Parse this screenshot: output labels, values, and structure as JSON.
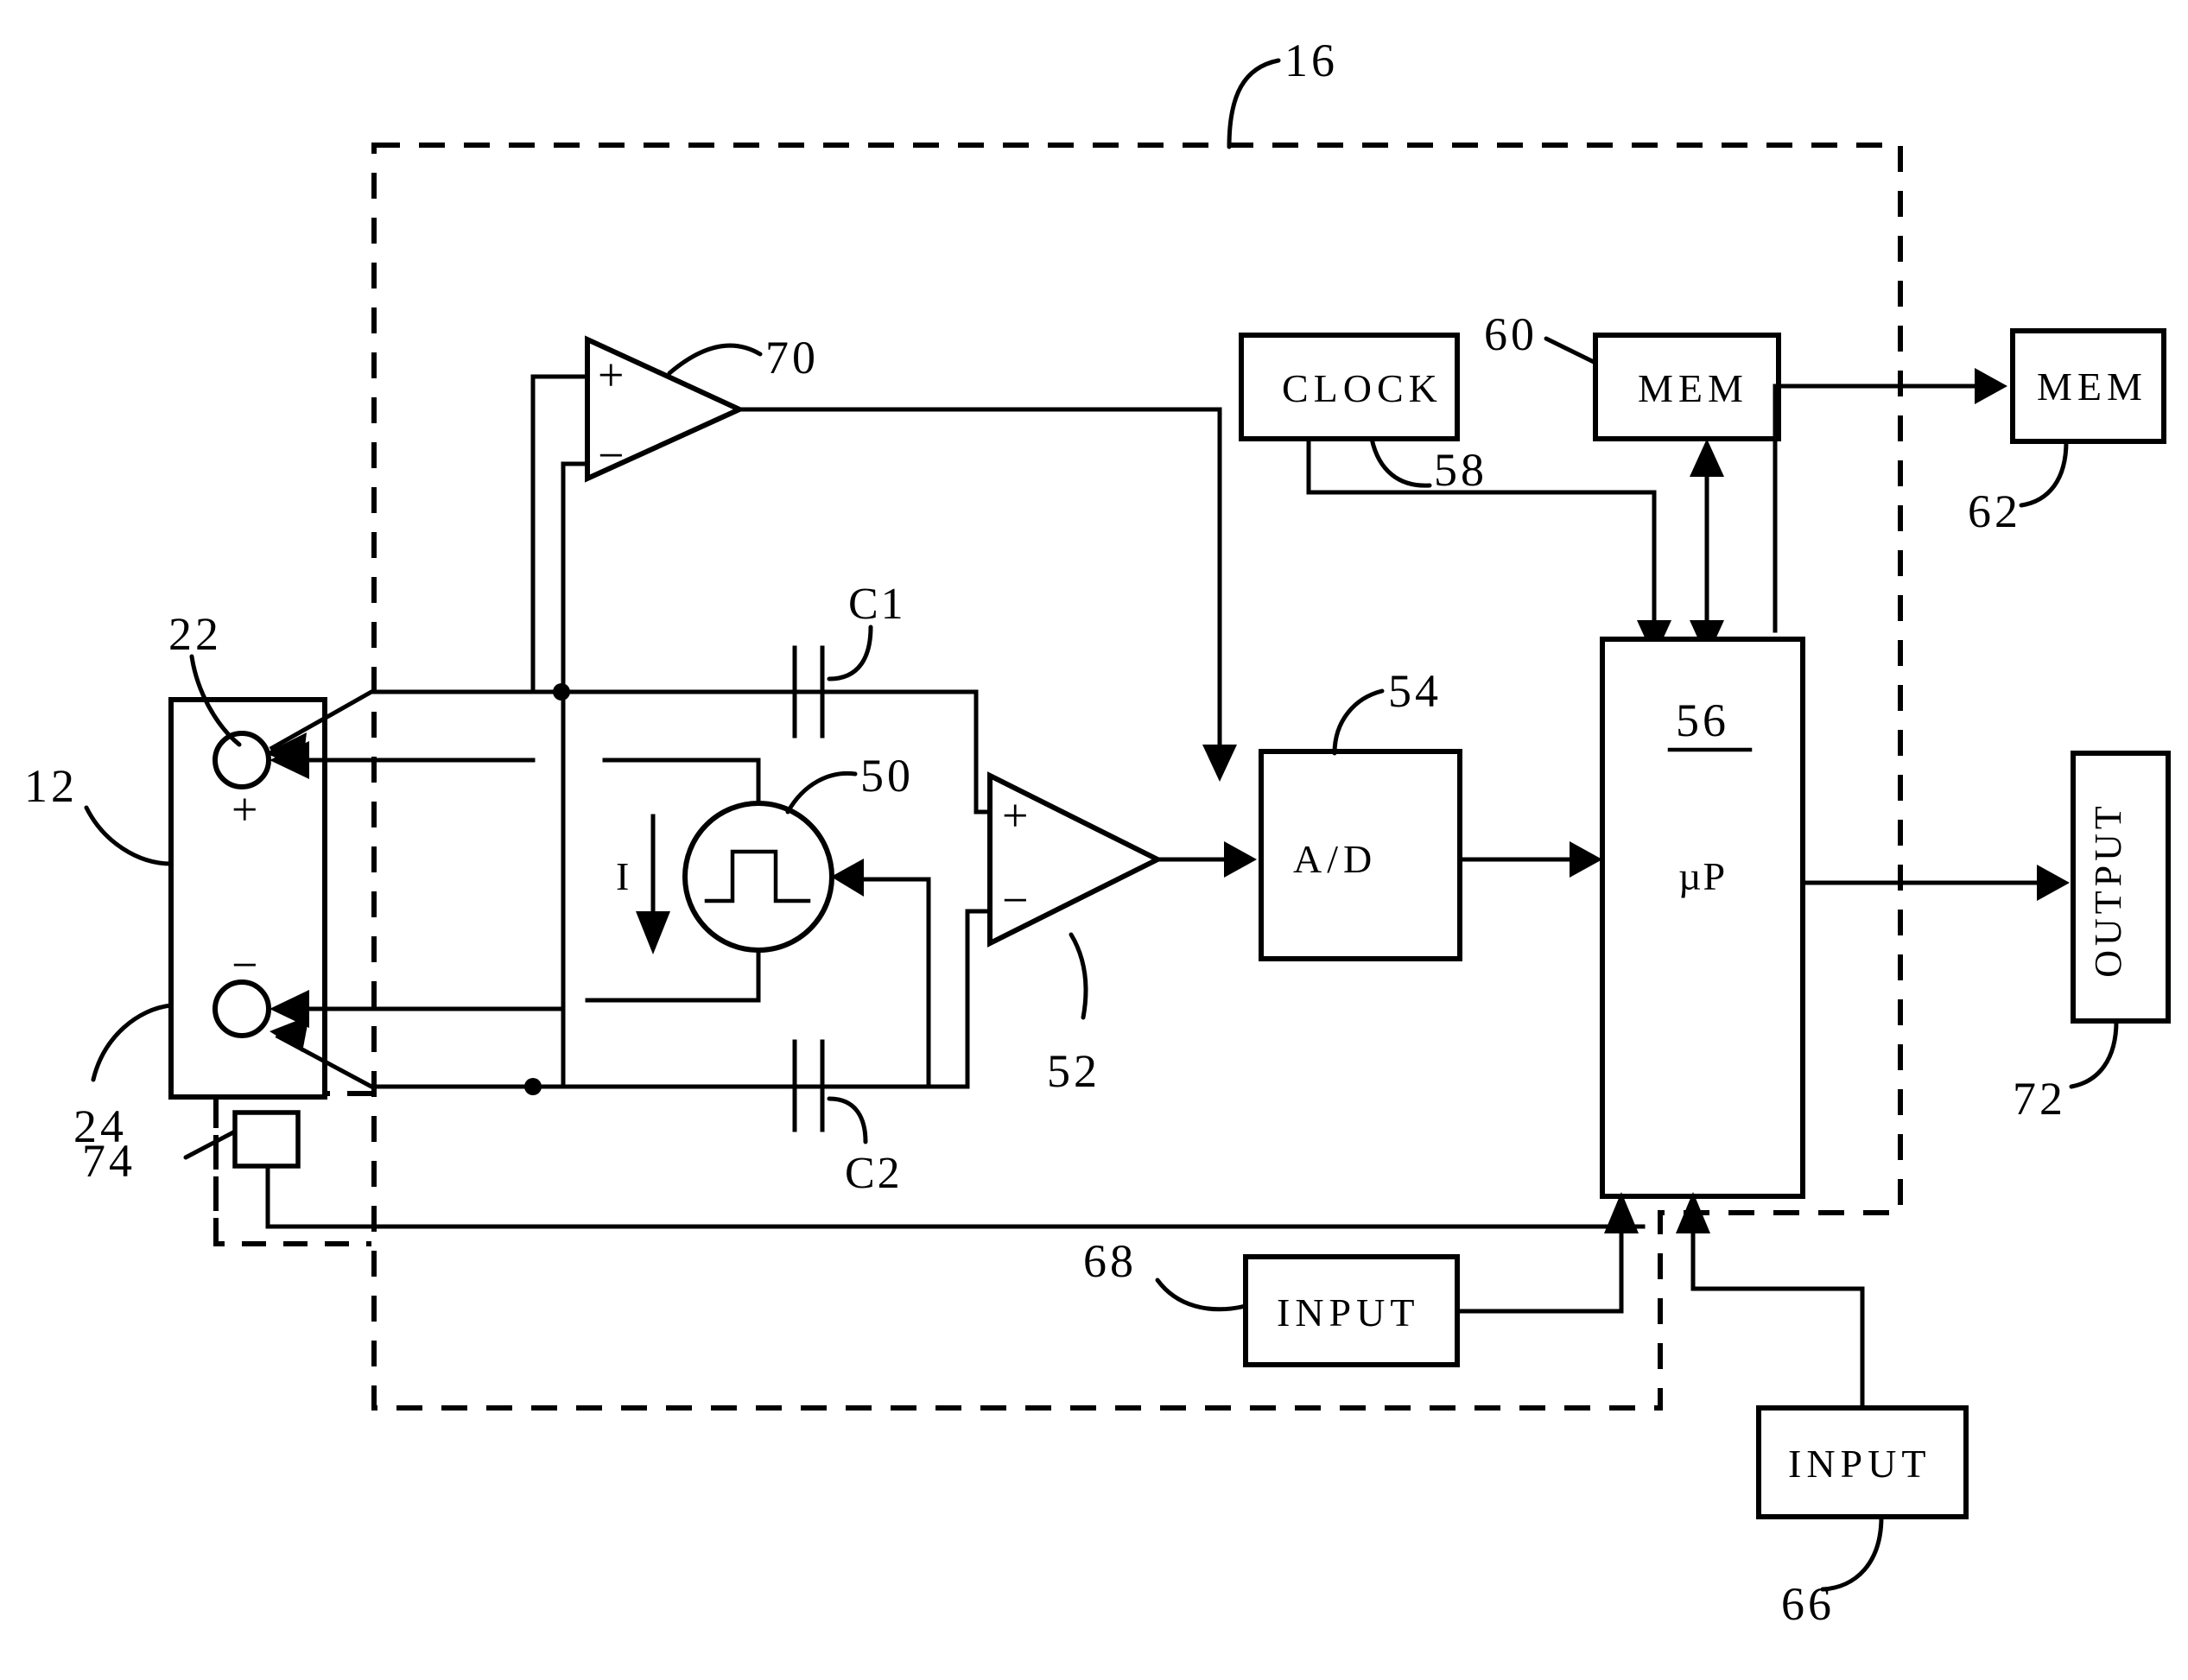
{
  "figure": {
    "type": "patent-block-diagram",
    "reference_numerals": {
      "system_boundary": "16",
      "sensor_assembly": "12",
      "electrode_positive": "22",
      "electrode_negative": "24",
      "current_source": "50",
      "amplifier_52": "52",
      "analog_to_digital": "54",
      "microprocessor": "56",
      "clock_line": "58",
      "memory_internal": "60",
      "memory_external": "62",
      "input_external": "66",
      "input_internal": "68",
      "buffer_amplifier": "70",
      "output": "72",
      "small_module": "74"
    },
    "blocks": [
      {
        "id": "clock",
        "label": "CLOCK",
        "numeral": "58"
      },
      {
        "id": "mem_internal",
        "label": "MEM",
        "numeral": "60"
      },
      {
        "id": "mem_external",
        "label": "MEM",
        "numeral": "62"
      },
      {
        "id": "ad",
        "label": "A/D",
        "numeral": "54"
      },
      {
        "id": "up",
        "label": "µP",
        "numeral": "56"
      },
      {
        "id": "output",
        "label": "OUTPUT",
        "numeral": "72"
      },
      {
        "id": "input_internal",
        "label": "INPUT",
        "numeral": "68"
      },
      {
        "id": "input_external",
        "label": "INPUT",
        "numeral": "66"
      }
    ],
    "components": [
      {
        "id": "c1",
        "label": "C1",
        "kind": "capacitor"
      },
      {
        "id": "c2",
        "label": "C2",
        "kind": "capacitor"
      },
      {
        "id": "i_arrow",
        "label": "I",
        "kind": "current-arrow"
      },
      {
        "id": "source50",
        "label": "50",
        "kind": "pulse-current-source"
      },
      {
        "id": "amp70",
        "label": "70",
        "kind": "op-amp"
      },
      {
        "id": "amp52",
        "label": "52",
        "kind": "op-amp"
      },
      {
        "id": "module74",
        "label": "74",
        "kind": "small-block"
      }
    ],
    "polarity_signs": {
      "electrode_plus": "+",
      "electrode_minus": "−",
      "amp70_plus": "+",
      "amp70_minus": "−",
      "amp52_plus": "+",
      "amp52_minus": "−"
    },
    "colors": {
      "ink": "#000000",
      "paper": "#ffffff"
    }
  }
}
